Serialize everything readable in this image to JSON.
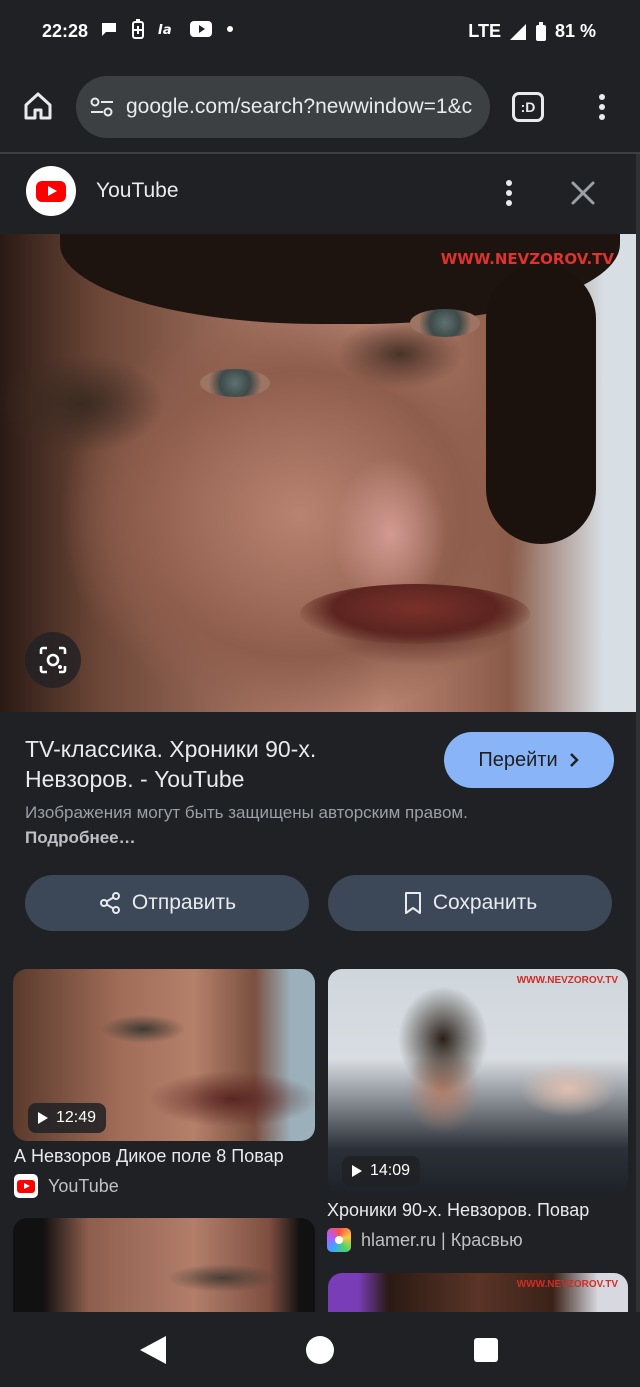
{
  "status_bar": {
    "time": "22:28",
    "network": "LTE",
    "battery": "81 %",
    "icons_left": [
      "chat-icon",
      "battery-saver-icon",
      "ia-icon",
      "youtube-icon",
      "dot-icon"
    ]
  },
  "browser": {
    "url": "google.com/search?newwindow=1&c",
    "tab_switcher_label": ":D"
  },
  "panel": {
    "source_name": "YouTube",
    "main_image_watermark": "WWW.NEVZOROV.TV",
    "title": "TV-классика. Хроники 90-х. Невзоров. - YouTube",
    "goto_label": "Перейти",
    "copyright_text": "Изображения могут быть защищены авторским правом.",
    "copyright_link": "Подробнее…",
    "share_label": "Отправить",
    "save_label": "Сохранить"
  },
  "results": [
    {
      "title": "А Невзоров Дикое поле 8 Повар",
      "source": "YouTube",
      "duration": "12:49"
    },
    {
      "title": "Хроники 90-х. Невзоров. Повар",
      "source": "hlamer.ru | Красвью",
      "duration": "14:09",
      "watermark": "WWW.NEVZOROV.TV"
    },
    {
      "title": "",
      "source": ""
    },
    {
      "title": "",
      "source": "",
      "watermark": "WWW.NEVZOROV.TV"
    }
  ],
  "colors": {
    "background": "#202124",
    "accent_button": "#8ab4f8",
    "action_button": "#3c4858",
    "youtube_red": "#ff0000"
  }
}
